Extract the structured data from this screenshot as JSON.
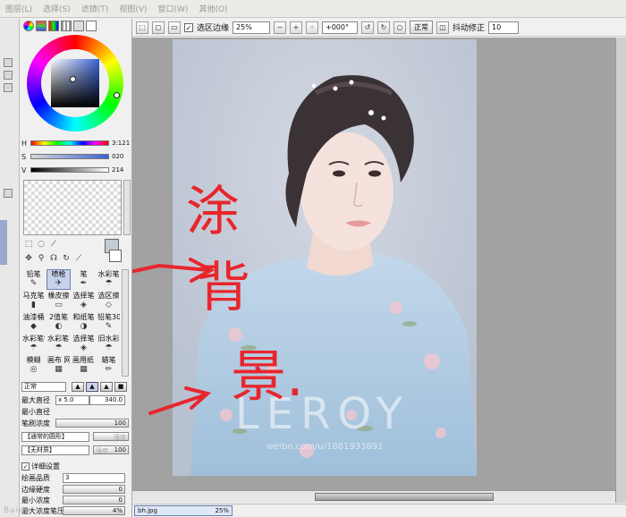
{
  "menu": [
    "图层(L)",
    "选择(S)",
    "滤镜(T)",
    "视图(V)",
    "窗口(W)",
    "其他(O)"
  ],
  "toolbar": {
    "select_edge_label": "选区边缘",
    "select_edge_checked": "✓",
    "zoom": "25%",
    "rotation": "+000°",
    "blend": "正常",
    "stabilizer_label": "抖动修正",
    "stabilizer_value": "10"
  },
  "color": {
    "hue_label": "H",
    "hue_value": "3:121",
    "sat_label": "S",
    "sat_value": "020",
    "val_label": "V",
    "val_value": "214",
    "current": "#c6cad2",
    "accent": "#3a63d6"
  },
  "brushes": [
    {
      "label": "铅笔",
      "icon": "pencil-icon"
    },
    {
      "label": "喷枪",
      "icon": "airbrush-icon",
      "selected": true
    },
    {
      "label": "笔",
      "icon": "pen-icon"
    },
    {
      "label": "水彩笔",
      "icon": "watercolor-icon"
    },
    {
      "label": "马克笔",
      "icon": "marker-icon"
    },
    {
      "label": "橡皮擦",
      "icon": "eraser-icon"
    },
    {
      "label": "选择笔",
      "icon": "select-pen-icon"
    },
    {
      "label": "选区擦",
      "icon": "select-eraser-icon"
    },
    {
      "label": "油漆桶",
      "icon": "bucket-icon"
    },
    {
      "label": "2值笔",
      "icon": "binary-pen-icon"
    },
    {
      "label": "和纸笔",
      "icon": "washi-pen-icon"
    },
    {
      "label": "铅笔30",
      "icon": "pencil30-icon"
    },
    {
      "label": "水彩笔9版",
      "icon": "watercolor9-icon"
    },
    {
      "label": "水彩笔10版",
      "icon": "watercolor10-icon"
    },
    {
      "label": "选择笔",
      "icon": "select-pen2-icon"
    },
    {
      "label": "旧水彩",
      "icon": "old-watercolor-icon"
    },
    {
      "label": "模糊",
      "icon": "blur-icon"
    },
    {
      "label": "画布 网格",
      "icon": "canvas-grid-icon"
    },
    {
      "label": "画用纸 网格",
      "icon": "paper-grid-icon"
    },
    {
      "label": "蜡笔",
      "icon": "crayon-icon"
    }
  ],
  "props": {
    "mode": "正常",
    "max_size_label": "最大直径",
    "max_size_mult": "x 5.0",
    "max_size_value": "340.0",
    "min_size_label": "最小直径",
    "density_label": "笔刷浓度",
    "density_value": "100",
    "shape_label": "【通常的圆形】",
    "shape_strength_label": "强度",
    "texture_label": "【无材质】",
    "texture_strength_label": "强度",
    "texture_strength_value": "100",
    "advanced_label": "详细设置",
    "quality_label": "绘画品质",
    "quality_value": "3",
    "edge_hardness_label": "边缘硬度",
    "edge_hardness_value": "0",
    "min_density_label": "最小浓度",
    "min_density_value": "0",
    "max_pressure_label": "最大浓度笔压",
    "max_pressure_value": "4%"
  },
  "canvas": {
    "annotation_chars": [
      "涂",
      "背",
      "景."
    ],
    "photo_watermark": "LEROY",
    "photo_weibo": "weibo.com/u/1881933891"
  },
  "status": {
    "file_name": "bh.jpg",
    "file_zoom": "25%"
  },
  "page_watermark": "Baidu"
}
